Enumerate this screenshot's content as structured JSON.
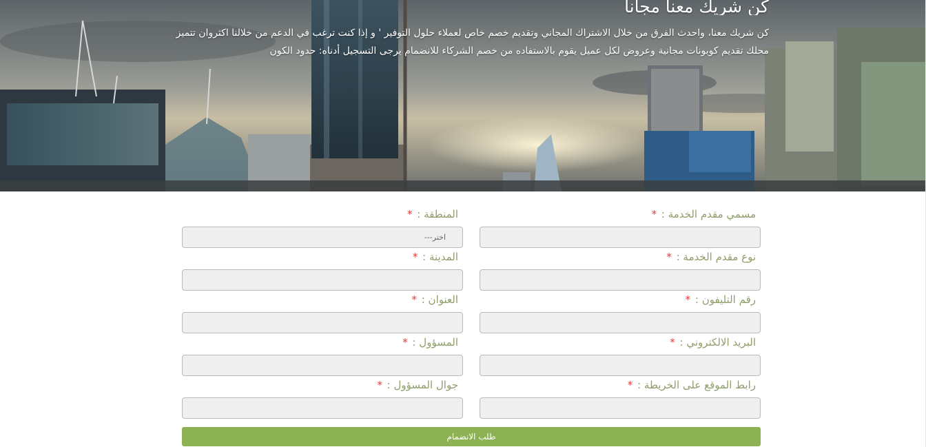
{
  "hero": {
    "title": "كن شريك معنا مجانا",
    "description": "كن شريك معنا، واحدث الفرق من خلال الاشتراك المجاني وتقديم خصم خاص لعملاء حلول التوفير ' و إذا كنت ترغب في الدعم من خلالنا اكثروان تتميز محلك تقديم كوبونات مجانية وعروض لكل عميل يقوم بالاستفاده من خصم الشركاء للانضمام يرجى التسجيل أدناه: حدود الكون"
  },
  "form": {
    "fields": [
      {
        "label": "مسمي مقدم الخدمة :",
        "required_mark": "*",
        "value": ""
      },
      {
        "label": "المنطقة :",
        "required_mark": "*",
        "value": "اختر---"
      },
      {
        "label": "نوع مقدم الخدمة :",
        "required_mark": "*",
        "value": ""
      },
      {
        "label": "المدينة :",
        "required_mark": "*",
        "value": ""
      },
      {
        "label": "رقم التليفون :",
        "required_mark": "*",
        "value": ""
      },
      {
        "label": "العنوان :",
        "required_mark": "*",
        "value": ""
      },
      {
        "label": "البريد الالكتروني :",
        "required_mark": "*",
        "value": ""
      },
      {
        "label": "المسؤول :",
        "required_mark": "*",
        "value": ""
      },
      {
        "label": "رابط الموقع على الخريطة :",
        "required_mark": "*",
        "value": ""
      },
      {
        "label": "جوال المسؤول :",
        "required_mark": "*",
        "value": ""
      }
    ],
    "submit_label": "طلب الانضمام"
  },
  "colors": {
    "label": "#8f9e6a",
    "required": "#e53935",
    "button": "#8db253",
    "input_bg": "#efefef"
  }
}
